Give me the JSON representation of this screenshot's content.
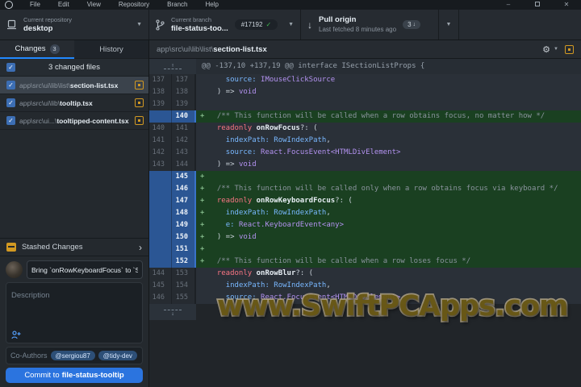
{
  "menu_bar": {
    "items": [
      "File",
      "Edit",
      "View",
      "Repository",
      "Branch",
      "Help"
    ]
  },
  "window_controls": {
    "minimize": "–",
    "maximize": "",
    "close": "✕"
  },
  "toolbar": {
    "repository": {
      "label": "Current repository",
      "value": "desktop"
    },
    "branch": {
      "label": "Current branch",
      "value": "file-status-too...",
      "pr_badge": "#17192"
    },
    "pull": {
      "title": "Pull origin",
      "subtitle": "Last fetched 8 minutes ago",
      "badge_count": "3"
    }
  },
  "sidebar": {
    "tabs": [
      {
        "label": "Changes",
        "badge": "3",
        "selected": true
      },
      {
        "label": "History",
        "selected": false
      }
    ],
    "files_header": "3 changed files",
    "files": [
      {
        "prefix": "app\\src\\ui\\lib\\list\\",
        "name": "section-list.tsx",
        "status": "modified",
        "checked": true,
        "selected": true
      },
      {
        "prefix": "app\\src\\ui\\lib\\",
        "name": "tooltip.tsx",
        "status": "modified",
        "checked": true,
        "selected": false
      },
      {
        "prefix": "app\\src\\ui...\\",
        "name": "tooltipped-content.tsx",
        "status": "modified",
        "checked": true,
        "selected": false
      }
    ],
    "stashed": "Stashed Changes",
    "commit": {
      "summary_value": "Bring `onRowKeyboardFocus` to `Se",
      "description_placeholder": "Description",
      "coauthors_label": "Co-Authors",
      "coauthors": [
        "@sergiou87",
        "@tidy-dev"
      ],
      "button_prefix": "Commit to ",
      "button_branch": "file-status-tooltip"
    }
  },
  "diff": {
    "file_path_prefix": "app\\src\\ui\\lib\\list\\",
    "file_name": "section-list.tsx",
    "hunk_header": "@@ -137,10 +137,19 @@ interface ISectionListProps {",
    "lines": [
      {
        "old": "137",
        "new": "137",
        "kind": "ctx",
        "tokens": [
          [
            "    ",
            "p"
          ],
          [
            "source:",
            "b"
          ],
          [
            " ",
            "p"
          ],
          [
            "IMouseClickSource",
            "t"
          ]
        ]
      },
      {
        "old": "138",
        "new": "138",
        "kind": "ctx",
        "tokens": [
          [
            "  ) => ",
            "p"
          ],
          [
            "void",
            "t"
          ]
        ]
      },
      {
        "old": "139",
        "new": "139",
        "kind": "ctx",
        "tokens": []
      },
      {
        "old": "",
        "new": "140",
        "kind": "add",
        "tokens": [
          [
            "  ",
            "p"
          ],
          [
            "/** This function will be called when a row obtains focus, no matter how */",
            "c"
          ]
        ]
      },
      {
        "old": "140",
        "new": "141",
        "kind": "ctx",
        "tokens": [
          [
            "  ",
            "p"
          ],
          [
            "readonly",
            "k"
          ],
          [
            " ",
            "p"
          ],
          [
            "onRowFocus",
            "f"
          ],
          [
            "?: (",
            "p"
          ]
        ]
      },
      {
        "old": "141",
        "new": "142",
        "kind": "ctx",
        "tokens": [
          [
            "    ",
            "p"
          ],
          [
            "indexPath:",
            "b"
          ],
          [
            " ",
            "p"
          ],
          [
            "RowIndexPath",
            "b"
          ],
          [
            ",",
            "p"
          ]
        ]
      },
      {
        "old": "142",
        "new": "143",
        "kind": "ctx",
        "tokens": [
          [
            "    ",
            "p"
          ],
          [
            "source:",
            "b"
          ],
          [
            " ",
            "p"
          ],
          [
            "React.FocusEvent<HTMLDivElement>",
            "t"
          ]
        ]
      },
      {
        "old": "143",
        "new": "144",
        "kind": "ctx",
        "tokens": [
          [
            "  ) => ",
            "p"
          ],
          [
            "void",
            "t"
          ]
        ]
      },
      {
        "old": "",
        "new": "145",
        "kind": "add",
        "tokens": []
      },
      {
        "old": "",
        "new": "146",
        "kind": "add",
        "tokens": [
          [
            "  ",
            "p"
          ],
          [
            "/** This function will be called only when a row obtains focus via keyboard */",
            "c"
          ]
        ]
      },
      {
        "old": "",
        "new": "147",
        "kind": "add",
        "tokens": [
          [
            "  ",
            "p"
          ],
          [
            "readonly",
            "k"
          ],
          [
            " ",
            "p"
          ],
          [
            "onRowKeyboardFocus",
            "f"
          ],
          [
            "?: (",
            "p"
          ]
        ]
      },
      {
        "old": "",
        "new": "148",
        "kind": "add",
        "tokens": [
          [
            "    ",
            "p"
          ],
          [
            "indexPath:",
            "b"
          ],
          [
            " ",
            "p"
          ],
          [
            "RowIndexPath",
            "b"
          ],
          [
            ",",
            "p"
          ]
        ]
      },
      {
        "old": "",
        "new": "149",
        "kind": "add",
        "tokens": [
          [
            "    ",
            "p"
          ],
          [
            "e:",
            "b"
          ],
          [
            " ",
            "p"
          ],
          [
            "React.KeyboardEvent<any>",
            "t"
          ]
        ]
      },
      {
        "old": "",
        "new": "150",
        "kind": "add",
        "tokens": [
          [
            "  ) => ",
            "p"
          ],
          [
            "void",
            "t"
          ]
        ]
      },
      {
        "old": "",
        "new": "151",
        "kind": "add",
        "tokens": []
      },
      {
        "old": "",
        "new": "152",
        "kind": "add",
        "tokens": [
          [
            "  ",
            "p"
          ],
          [
            "/** This function will be called when a row loses focus */",
            "c"
          ]
        ]
      },
      {
        "old": "144",
        "new": "153",
        "kind": "ctx",
        "tokens": [
          [
            "  ",
            "p"
          ],
          [
            "readonly",
            "k"
          ],
          [
            " ",
            "p"
          ],
          [
            "onRowBlur",
            "f"
          ],
          [
            "?: (",
            "p"
          ]
        ]
      },
      {
        "old": "145",
        "new": "154",
        "kind": "ctx",
        "tokens": [
          [
            "    ",
            "p"
          ],
          [
            "indexPath:",
            "b"
          ],
          [
            " ",
            "p"
          ],
          [
            "RowIndexPath",
            "b"
          ],
          [
            ",",
            "p"
          ]
        ]
      },
      {
        "old": "146",
        "new": "155",
        "kind": "ctx",
        "tokens": [
          [
            "    ",
            "p"
          ],
          [
            "source:",
            "b"
          ],
          [
            " ",
            "p"
          ],
          [
            "React.FocusEvent<HTMLDivElement>",
            "t"
          ]
        ]
      }
    ]
  },
  "watermark": "www.SwiftPCApps.com",
  "colors": {
    "accent_blue": "#2b74df",
    "added_line_bg": "#1a4021",
    "added_gutter_bg": "#2b5694",
    "modified_icon": "#d29922",
    "pr_check_green": "#3fb950",
    "watermark_gold": "#6b5a16"
  }
}
